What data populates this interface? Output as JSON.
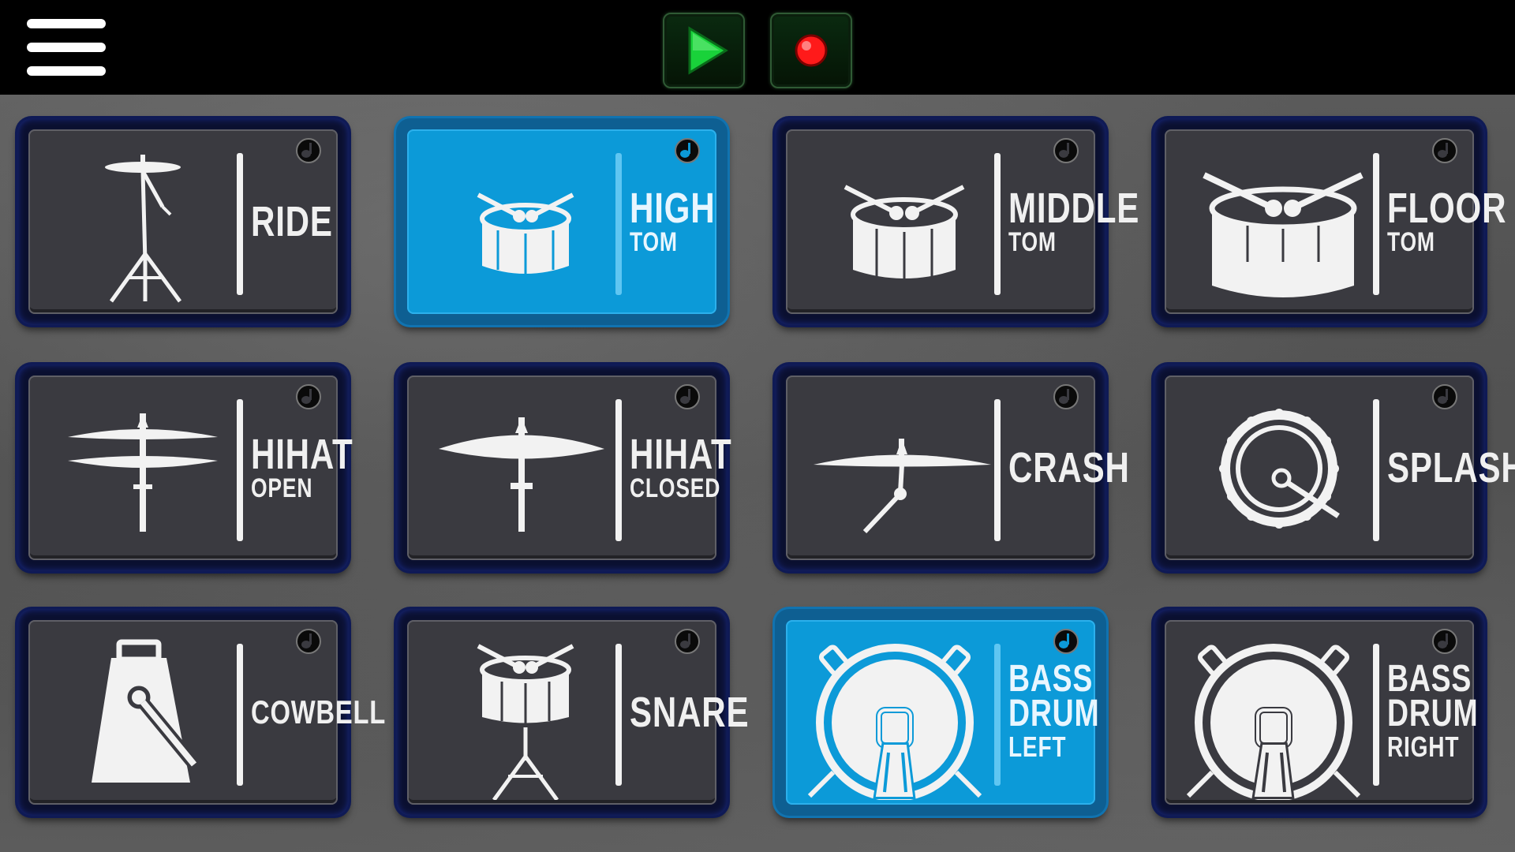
{
  "toolbar": {
    "menu_icon": "hamburger-menu-icon",
    "play_icon": "play-icon",
    "record_icon": "record-icon",
    "play_color": "#19d23a",
    "record_color": "#ff1a1a"
  },
  "colors": {
    "pad_face": "#3a3a40",
    "pad_active": "#0c9ad8",
    "pad_border": "#0f1a55"
  },
  "pads": [
    {
      "main": "RIDE",
      "sub": "",
      "icon": "ride-cymbal-icon",
      "active": false
    },
    {
      "main": "HIGH",
      "sub": "TOM",
      "icon": "high-tom-drum-icon",
      "active": true
    },
    {
      "main": "MIDDLE",
      "sub": "TOM",
      "icon": "middle-tom-drum-icon",
      "active": false
    },
    {
      "main": "FLOOR",
      "sub": "TOM",
      "icon": "floor-tom-drum-icon",
      "active": false
    },
    {
      "main": "HIHAT",
      "sub": "OPEN",
      "icon": "hihat-open-icon",
      "active": false
    },
    {
      "main": "HIHAT",
      "sub": "CLOSED",
      "icon": "hihat-closed-icon",
      "active": false
    },
    {
      "main": "CRASH",
      "sub": "",
      "icon": "crash-cymbal-icon",
      "active": false
    },
    {
      "main": "SPLASH",
      "sub": "",
      "icon": "splash-drum-icon",
      "active": false
    },
    {
      "main": "COWBELL",
      "sub": "",
      "icon": "cowbell-icon",
      "active": false
    },
    {
      "main": "SNARE",
      "sub": "",
      "icon": "snare-drum-icon",
      "active": false
    },
    {
      "lines": [
        "BASS",
        "DRUM",
        "LEFT"
      ],
      "icon": "bass-drum-left-icon",
      "active": true
    },
    {
      "lines": [
        "BASS",
        "DRUM",
        "RIGHT"
      ],
      "icon": "bass-drum-right-icon",
      "active": false
    }
  ]
}
